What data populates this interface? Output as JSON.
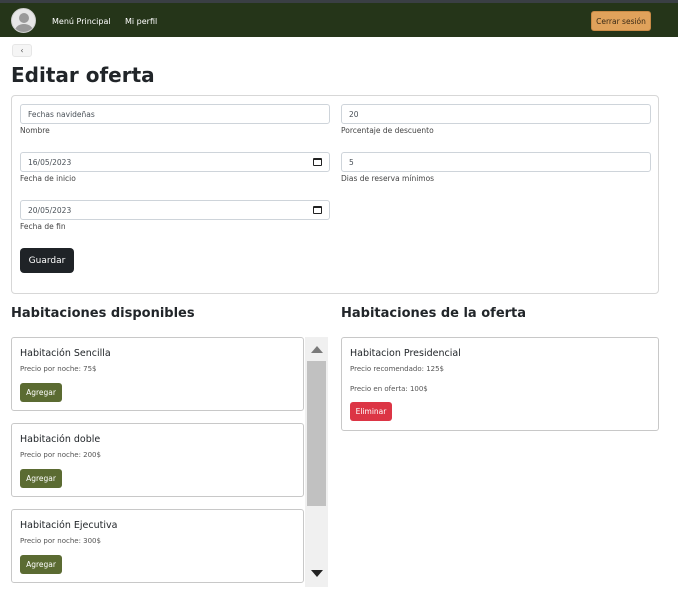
{
  "nav": {
    "home_label": "Menú Principal",
    "profile_label": "Mi perfil",
    "logout_label": "Cerrar sesión"
  },
  "back_label": "‹",
  "page_title": "Editar oferta",
  "form": {
    "nombre": {
      "value": "Fechas navideñas",
      "label": "Nombre"
    },
    "descuento": {
      "value": "20",
      "label": "Porcentaje de descuento"
    },
    "fecha_inicio": {
      "value": "16/05/2023",
      "label": "Fecha de inicio"
    },
    "dias_minimos": {
      "value": "5",
      "label": "Dias de reserva mínimos"
    },
    "fecha_fin": {
      "value": "20/05/2023",
      "label": "Fecha de fin"
    },
    "save_label": "Guardar"
  },
  "available": {
    "title": "Habitaciones disponibles",
    "add_label": "Agregar",
    "rooms": [
      {
        "name": "Habitación Sencilla",
        "price": "Precio por noche: 75$"
      },
      {
        "name": "Habitación doble",
        "price": "Precio por noche: 200$"
      },
      {
        "name": "Habitación Ejecutiva",
        "price": "Precio por noche: 300$"
      }
    ]
  },
  "offer": {
    "title": "Habitaciones de la oferta",
    "room_name": "Habitacion Presidencial",
    "recommended": "Precio recomendado: 125$",
    "offer_price": "Precio en oferta: 100$",
    "delete_label": "Eliminar"
  },
  "colors": {
    "navbar": "#253519",
    "logout": "#e0a25b",
    "add_button": "#5b6b32",
    "delete_button": "#dc3545",
    "save_button": "#1f2327"
  }
}
